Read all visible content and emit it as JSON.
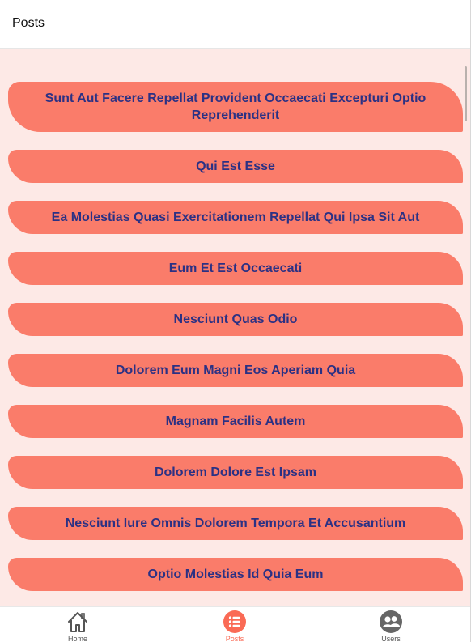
{
  "header": {
    "title": "Posts"
  },
  "posts": [
    "Sunt Aut Facere Repellat Provident Occaecati Excepturi Optio Reprehenderit",
    "Qui Est Esse",
    "Ea Molestias Quasi Exercitationem Repellat Qui Ipsa Sit Aut",
    "Eum Et Est Occaecati",
    "Nesciunt Quas Odio",
    "Dolorem Eum Magni Eos Aperiam Quia",
    "Magnam Facilis Autem",
    "Dolorem Dolore Est Ipsam",
    "Nesciunt Iure Omnis Dolorem Tempora Et Accusantium",
    "Optio Molestias Id Quia Eum"
  ],
  "tabbar": {
    "active_tab": "Posts",
    "tabs": [
      {
        "label": "Home",
        "icon": "home-icon"
      },
      {
        "label": "Posts",
        "icon": "list-icon"
      },
      {
        "label": "Users",
        "icon": "users-icon"
      }
    ]
  },
  "colors": {
    "accent": "#fa7c6a",
    "background": "#fde9e6",
    "post_text": "#2b3184",
    "active_tab": "#fa6a55"
  }
}
